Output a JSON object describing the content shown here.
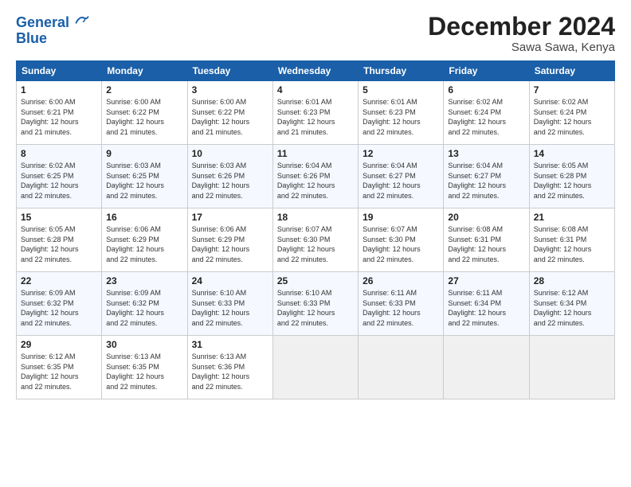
{
  "logo": {
    "line1": "General",
    "line2": "Blue"
  },
  "title": "December 2024",
  "location": "Sawa Sawa, Kenya",
  "days_of_week": [
    "Sunday",
    "Monday",
    "Tuesday",
    "Wednesday",
    "Thursday",
    "Friday",
    "Saturday"
  ],
  "weeks": [
    [
      {
        "day": "1",
        "info": "Sunrise: 6:00 AM\nSunset: 6:21 PM\nDaylight: 12 hours\nand 21 minutes."
      },
      {
        "day": "2",
        "info": "Sunrise: 6:00 AM\nSunset: 6:22 PM\nDaylight: 12 hours\nand 21 minutes."
      },
      {
        "day": "3",
        "info": "Sunrise: 6:00 AM\nSunset: 6:22 PM\nDaylight: 12 hours\nand 21 minutes."
      },
      {
        "day": "4",
        "info": "Sunrise: 6:01 AM\nSunset: 6:23 PM\nDaylight: 12 hours\nand 21 minutes."
      },
      {
        "day": "5",
        "info": "Sunrise: 6:01 AM\nSunset: 6:23 PM\nDaylight: 12 hours\nand 22 minutes."
      },
      {
        "day": "6",
        "info": "Sunrise: 6:02 AM\nSunset: 6:24 PM\nDaylight: 12 hours\nand 22 minutes."
      },
      {
        "day": "7",
        "info": "Sunrise: 6:02 AM\nSunset: 6:24 PM\nDaylight: 12 hours\nand 22 minutes."
      }
    ],
    [
      {
        "day": "8",
        "info": "Sunrise: 6:02 AM\nSunset: 6:25 PM\nDaylight: 12 hours\nand 22 minutes."
      },
      {
        "day": "9",
        "info": "Sunrise: 6:03 AM\nSunset: 6:25 PM\nDaylight: 12 hours\nand 22 minutes."
      },
      {
        "day": "10",
        "info": "Sunrise: 6:03 AM\nSunset: 6:26 PM\nDaylight: 12 hours\nand 22 minutes."
      },
      {
        "day": "11",
        "info": "Sunrise: 6:04 AM\nSunset: 6:26 PM\nDaylight: 12 hours\nand 22 minutes."
      },
      {
        "day": "12",
        "info": "Sunrise: 6:04 AM\nSunset: 6:27 PM\nDaylight: 12 hours\nand 22 minutes."
      },
      {
        "day": "13",
        "info": "Sunrise: 6:04 AM\nSunset: 6:27 PM\nDaylight: 12 hours\nand 22 minutes."
      },
      {
        "day": "14",
        "info": "Sunrise: 6:05 AM\nSunset: 6:28 PM\nDaylight: 12 hours\nand 22 minutes."
      }
    ],
    [
      {
        "day": "15",
        "info": "Sunrise: 6:05 AM\nSunset: 6:28 PM\nDaylight: 12 hours\nand 22 minutes."
      },
      {
        "day": "16",
        "info": "Sunrise: 6:06 AM\nSunset: 6:29 PM\nDaylight: 12 hours\nand 22 minutes."
      },
      {
        "day": "17",
        "info": "Sunrise: 6:06 AM\nSunset: 6:29 PM\nDaylight: 12 hours\nand 22 minutes."
      },
      {
        "day": "18",
        "info": "Sunrise: 6:07 AM\nSunset: 6:30 PM\nDaylight: 12 hours\nand 22 minutes."
      },
      {
        "day": "19",
        "info": "Sunrise: 6:07 AM\nSunset: 6:30 PM\nDaylight: 12 hours\nand 22 minutes."
      },
      {
        "day": "20",
        "info": "Sunrise: 6:08 AM\nSunset: 6:31 PM\nDaylight: 12 hours\nand 22 minutes."
      },
      {
        "day": "21",
        "info": "Sunrise: 6:08 AM\nSunset: 6:31 PM\nDaylight: 12 hours\nand 22 minutes."
      }
    ],
    [
      {
        "day": "22",
        "info": "Sunrise: 6:09 AM\nSunset: 6:32 PM\nDaylight: 12 hours\nand 22 minutes."
      },
      {
        "day": "23",
        "info": "Sunrise: 6:09 AM\nSunset: 6:32 PM\nDaylight: 12 hours\nand 22 minutes."
      },
      {
        "day": "24",
        "info": "Sunrise: 6:10 AM\nSunset: 6:33 PM\nDaylight: 12 hours\nand 22 minutes."
      },
      {
        "day": "25",
        "info": "Sunrise: 6:10 AM\nSunset: 6:33 PM\nDaylight: 12 hours\nand 22 minutes."
      },
      {
        "day": "26",
        "info": "Sunrise: 6:11 AM\nSunset: 6:33 PM\nDaylight: 12 hours\nand 22 minutes."
      },
      {
        "day": "27",
        "info": "Sunrise: 6:11 AM\nSunset: 6:34 PM\nDaylight: 12 hours\nand 22 minutes."
      },
      {
        "day": "28",
        "info": "Sunrise: 6:12 AM\nSunset: 6:34 PM\nDaylight: 12 hours\nand 22 minutes."
      }
    ],
    [
      {
        "day": "29",
        "info": "Sunrise: 6:12 AM\nSunset: 6:35 PM\nDaylight: 12 hours\nand 22 minutes."
      },
      {
        "day": "30",
        "info": "Sunrise: 6:13 AM\nSunset: 6:35 PM\nDaylight: 12 hours\nand 22 minutes."
      },
      {
        "day": "31",
        "info": "Sunrise: 6:13 AM\nSunset: 6:36 PM\nDaylight: 12 hours\nand 22 minutes."
      },
      {
        "day": "",
        "info": ""
      },
      {
        "day": "",
        "info": ""
      },
      {
        "day": "",
        "info": ""
      },
      {
        "day": "",
        "info": ""
      }
    ]
  ]
}
